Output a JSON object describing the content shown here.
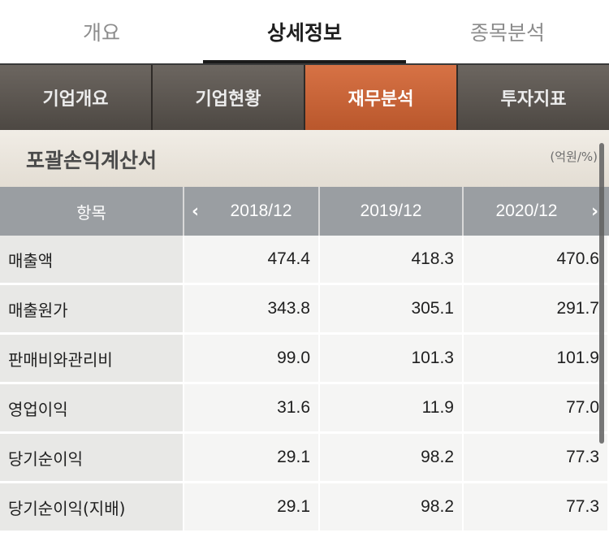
{
  "top_tabs": [
    {
      "label": "개요",
      "active": false
    },
    {
      "label": "상세정보",
      "active": true
    },
    {
      "label": "종목분석",
      "active": false
    }
  ],
  "sub_tabs": [
    {
      "label": "기업개요",
      "active": false
    },
    {
      "label": "기업현황",
      "active": false
    },
    {
      "label": "재무분석",
      "active": true
    },
    {
      "label": "투자지표",
      "active": false
    }
  ],
  "section": {
    "title": "포괄손익계산서",
    "unit": "(억원/%)"
  },
  "table": {
    "item_header": "항목",
    "periods": [
      "2018/12",
      "2019/12",
      "2020/12"
    ],
    "rows": [
      {
        "label": "매출액",
        "values": [
          "474.4",
          "418.3",
          "470.6"
        ]
      },
      {
        "label": "매출원가",
        "values": [
          "343.8",
          "305.1",
          "291.7"
        ]
      },
      {
        "label": "판매비와관리비",
        "values": [
          "99.0",
          "101.3",
          "101.9"
        ]
      },
      {
        "label": "영업이익",
        "values": [
          "31.6",
          "11.9",
          "77.0"
        ]
      },
      {
        "label": "당기순이익",
        "values": [
          "29.1",
          "98.2",
          "77.3"
        ]
      },
      {
        "label": "당기순이익(지배)",
        "values": [
          "29.1",
          "98.2",
          "77.3"
        ]
      }
    ]
  },
  "icons": {
    "prev": "chevron-left-icon",
    "next": "chevron-right-icon"
  },
  "colors": {
    "active_subtab": "#c8623a",
    "header_gray": "#9a9ea2"
  }
}
